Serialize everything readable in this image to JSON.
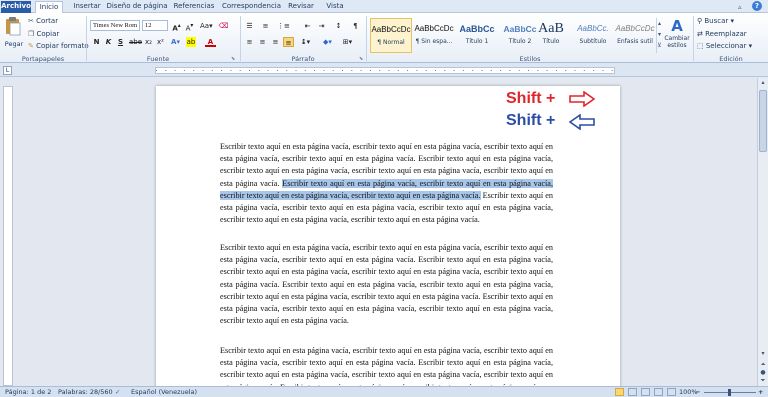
{
  "tabs": [
    "Archivo",
    "Inicio",
    "Insertar",
    "Diseño de página",
    "Referencias",
    "Correspondencia",
    "Revisar",
    "Vista"
  ],
  "clipboard": {
    "paste": "Pegar",
    "cut": "Cortar",
    "copy": "Copiar",
    "format_painter": "Copiar formato",
    "label": "Portapapeles"
  },
  "font": {
    "name": "Times New Rom",
    "size": "12",
    "label": "Fuente"
  },
  "paragraph": {
    "label": "Párrafo"
  },
  "styles": {
    "label": "Estilos",
    "items": [
      {
        "preview": "AaBbCcDc",
        "name": "¶ Normal"
      },
      {
        "preview": "AaBbCcDc",
        "name": "¶ Sin espa..."
      },
      {
        "preview": "AaBbCc",
        "name": "Título 1"
      },
      {
        "preview": "AaBbCc",
        "name": "Título 2"
      },
      {
        "preview": "AaB",
        "name": "Título"
      },
      {
        "preview": "AaBbCc.",
        "name": "Subtítulo"
      },
      {
        "preview": "AaBbCcDc",
        "name": "Énfasis sutil"
      }
    ],
    "change": "Cambiar estilos"
  },
  "editing": {
    "find": "Buscar",
    "replace": "Reemplazar",
    "select": "Seleccionar",
    "label": "Edición"
  },
  "shortcuts": [
    {
      "text": "Shift +",
      "color": "#e0252c",
      "arrow": "right"
    },
    {
      "text": "Shift +",
      "color": "#2d4da3",
      "arrow": "left"
    }
  ],
  "doc": {
    "p1_pre": "Escribir texto aquí en esta página vacía, escribir texto aquí en esta página vacía, escribir texto aquí en esta página vacía, escribir texto aquí en esta página vacía. Escribir texto aquí en esta página vacía, escribir texto aquí en esta página vacía, escribir texto aquí en esta página vacía, escribir texto aquí en esta página vacía. ",
    "p1_sel": "Escribir texto aquí en esta página vacía, escribir texto aquí en esta página vacía, escribir texto aquí en esta página vacía, escribir texto aquí en esta página vacía.",
    "p1_post": " Escribir texto aquí en esta página vacía, escribir texto aquí en esta página vacía, escribir texto aquí en esta página vacía, escribir texto aquí en esta página vacía, escribir texto aquí en esta página vacía.",
    "p2": "Escribir texto aquí en esta página vacía, escribir texto aquí en esta página vacía, escribir texto aquí en esta página vacía, escribir texto aquí en esta página vacía. Escribir texto aquí en esta página vacía, escribir texto aquí en esta página vacía, escribir texto aquí en esta página vacía, escribir texto aquí en esta página vacía. Escribir texto aquí en esta página vacía, escribir texto aquí en esta página vacía, escribir texto aquí en esta página vacía, escribir texto aquí en esta página vacía. Escribir texto aquí en esta página vacía, escribir texto aquí en esta página vacía, escribir texto aquí en esta página vacía, escribir texto aquí en esta página vacía.",
    "p3": "Escribir texto aquí en esta página vacía, escribir texto aquí en esta página vacía, escribir texto aquí en esta página vacía, escribir texto aquí en esta página vacía. Escribir texto aquí en esta página vacía, escribir texto aquí en esta página vacía, escribir texto aquí en esta página vacía, escribir texto aquí en esta página vacía. Escribir texto aquí en esta página vacía, escribir texto aquí en esta página vacía."
  },
  "status": {
    "page": "Página: 1 de 2",
    "words": "Palabras: 28/560",
    "language": "Español (Venezuela)",
    "zoom": "100%"
  }
}
